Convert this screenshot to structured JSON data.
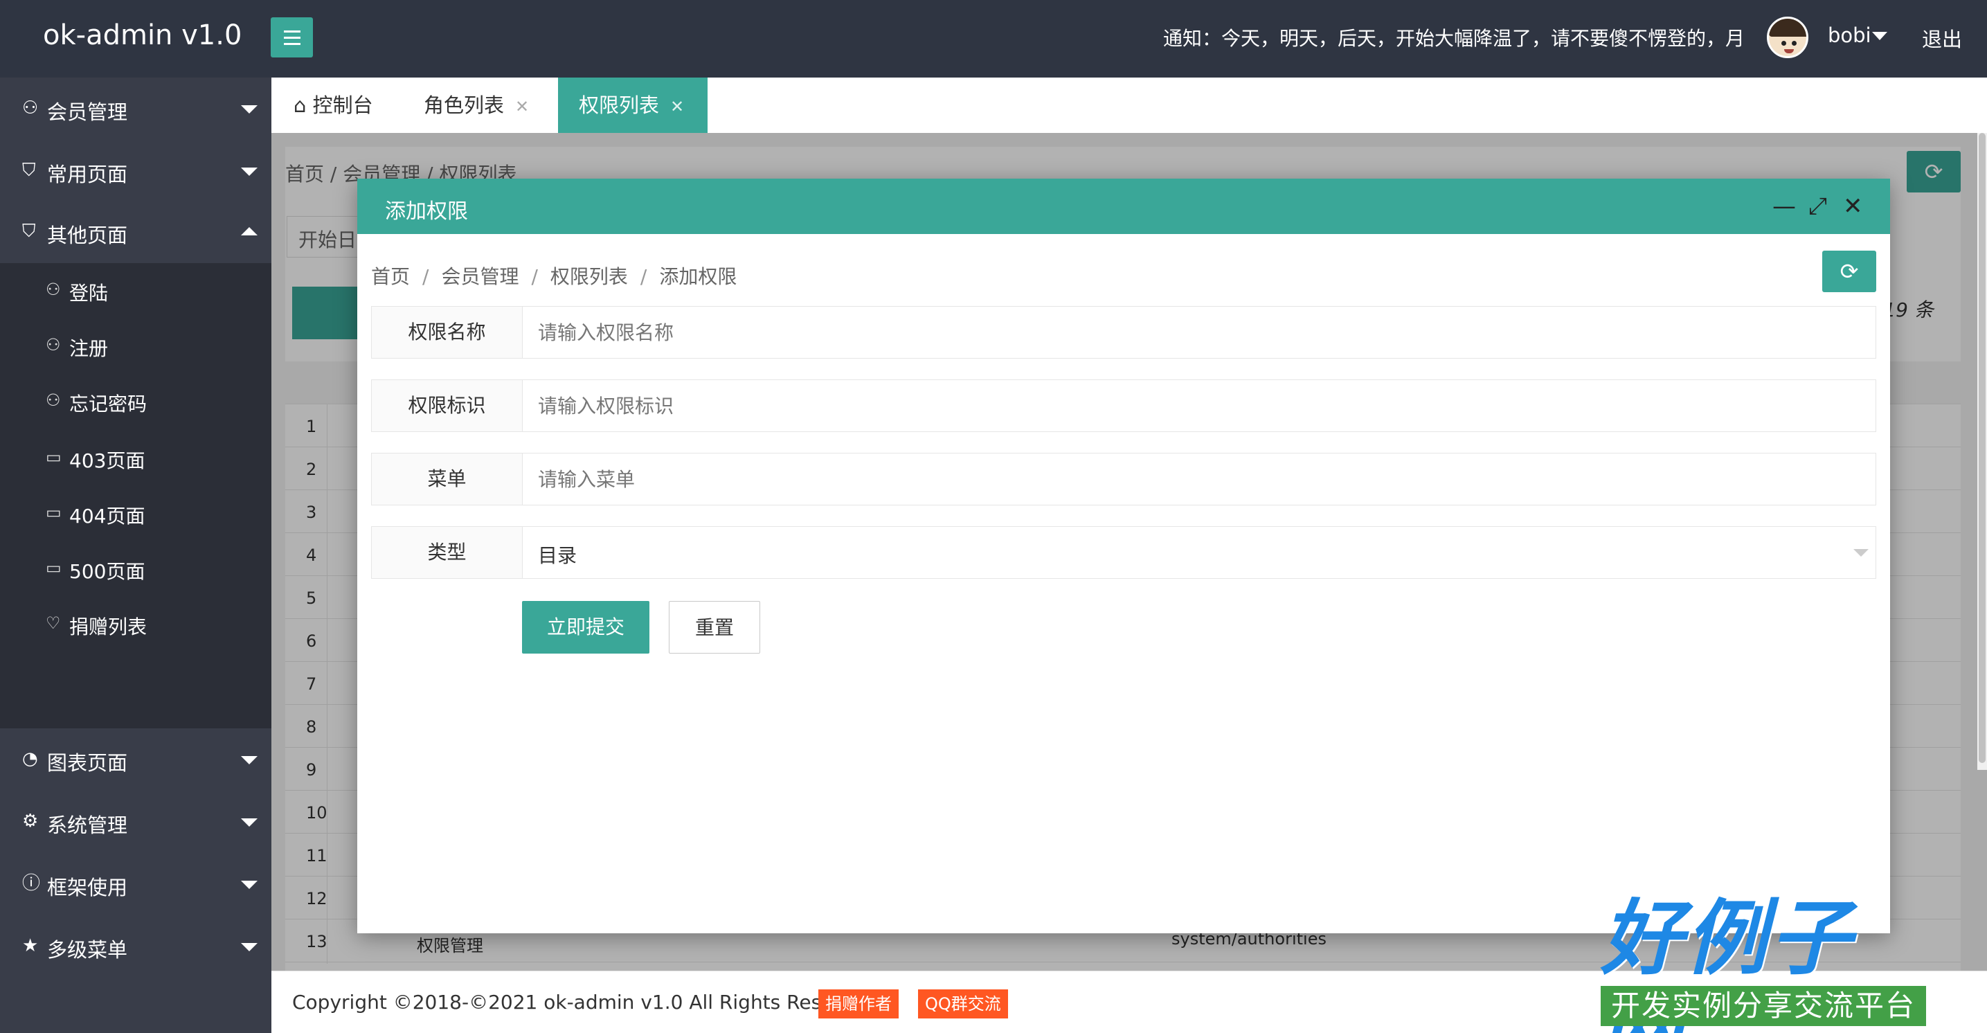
{
  "header": {
    "logo": "ok-admin v1.0",
    "notice": "通知：今天，明天，后天，开始大幅降温了，请不要傻不愣登的，月",
    "username": "bobi",
    "logout": "退出"
  },
  "sidebar": {
    "items": [
      {
        "label": "会员管理",
        "icon": "user-icon"
      },
      {
        "label": "常用页面",
        "icon": "shield-icon"
      },
      {
        "label": "其他页面",
        "icon": "shield-icon"
      },
      {
        "label": "图表页面",
        "icon": "chart-icon"
      },
      {
        "label": "系统管理",
        "icon": "gear-icon"
      },
      {
        "label": "框架使用",
        "icon": "info-icon"
      },
      {
        "label": "多级菜单",
        "icon": "star-icon"
      }
    ],
    "sub_items": [
      {
        "label": "登陆",
        "icon": "user-icon"
      },
      {
        "label": "注册",
        "icon": "user-icon"
      },
      {
        "label": "忘记密码",
        "icon": "user-icon"
      },
      {
        "label": "403页面",
        "icon": "error-page-icon"
      },
      {
        "label": "404页面",
        "icon": "error-page-icon"
      },
      {
        "label": "500页面",
        "icon": "error-page-icon"
      },
      {
        "label": "捐赠列表",
        "icon": "heart-icon"
      }
    ]
  },
  "tabs": [
    {
      "label": "控制台"
    },
    {
      "label": "角色列表",
      "close": "✕"
    },
    {
      "label": "权限列表",
      "close": "✕"
    }
  ],
  "background_page": {
    "breadcrumb": "首页 / 会员管理 / 权限列表",
    "date_input": "开始日",
    "total": ": 19 条",
    "rows": [
      "1",
      "2",
      "3",
      "4",
      "5",
      "6",
      "7",
      "8",
      "9",
      "10",
      "11",
      "12",
      "13"
    ],
    "row13_name": "权限管理",
    "row13_path": "system/authorities"
  },
  "modal": {
    "title": "添加权限",
    "breadcrumb": [
      "首页",
      "会员管理",
      "权限列表",
      "添加权限"
    ],
    "fields": [
      {
        "label": "权限名称",
        "placeholder": "请输入权限名称"
      },
      {
        "label": "权限标识",
        "placeholder": "请输入权限标识"
      },
      {
        "label": "菜单",
        "placeholder": "请输入菜单"
      }
    ],
    "type_field": {
      "label": "类型",
      "value": "目录"
    },
    "submit": "立即提交",
    "reset": "重置"
  },
  "footer": {
    "copyright": "Copyright ©2018-©2021 ok-admin v1.0 All Rights Reserved",
    "donate": "捐赠作者",
    "qq": "QQ群交流"
  },
  "watermark": {
    "title": "好例子网",
    "subtitle": "开发实例分享交流平台"
  }
}
